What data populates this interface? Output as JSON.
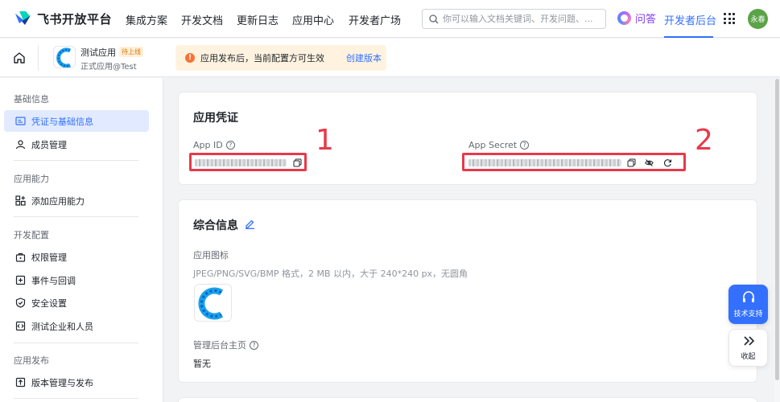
{
  "brand": {
    "name": "飞书开放平台"
  },
  "topnav": {
    "items": [
      "集成方案",
      "开发文档",
      "更新日志",
      "应用中心",
      "开发者广场"
    ],
    "search_placeholder": "你可以输入文档关键词、开发问题、...",
    "ask_label": "问答",
    "dev_console": "开发者后台",
    "avatar_text": "永春"
  },
  "appbar": {
    "app_name": "测试应用",
    "app_badge": "待上线",
    "app_sub": "正式应用@Test",
    "notice_text": "应用发布后，当前配置方可生效",
    "notice_link": "创建版本"
  },
  "sidebar": {
    "sections": [
      {
        "title": "基础信息",
        "items": [
          "凭证与基础信息",
          "成员管理"
        ]
      },
      {
        "title": "应用能力",
        "items": [
          "添加应用能力"
        ]
      },
      {
        "title": "开发配置",
        "items": [
          "权限管理",
          "事件与回调",
          "安全设置",
          "测试企业和人员"
        ]
      },
      {
        "title": "应用发布",
        "items": [
          "版本管理与发布"
        ]
      }
    ]
  },
  "credentials": {
    "title": "应用凭证",
    "app_id_label": "App ID",
    "app_secret_label": "App Secret",
    "annotation_1": "1",
    "annotation_2": "2"
  },
  "general": {
    "title": "综合信息",
    "icon_label": "应用图标",
    "icon_hint": "JPEG/PNG/SVG/BMP 格式，2 MB 以内，大于 240*240 px，无圆角",
    "homepage_label": "管理后台主页",
    "homepage_value": "暂无"
  },
  "floating": {
    "support_label": "技术支持",
    "collapse_label": "收起"
  },
  "colors": {
    "accent": "#3370ff",
    "annotation_red": "#e8394a",
    "warn": "#f77234"
  }
}
